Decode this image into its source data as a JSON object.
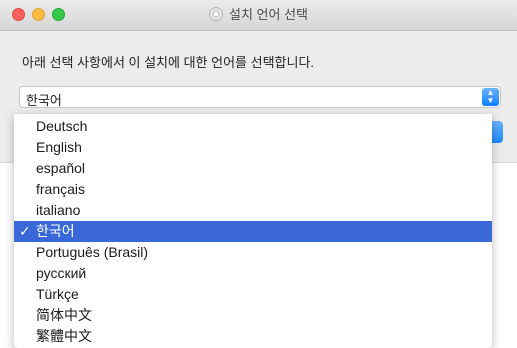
{
  "window": {
    "title": "설치 언어 선택",
    "instruction": "아래 선택 사항에서 이 설치에 대한 언어를 선택합니다."
  },
  "language_popup": {
    "selected_value": "한국어",
    "stepper_up": "▲",
    "stepper_down": "▼"
  },
  "menu": {
    "checkmark": "✓",
    "items": [
      {
        "label": "Deutsch"
      },
      {
        "label": "English"
      },
      {
        "label": "español"
      },
      {
        "label": "français"
      },
      {
        "label": "italiano"
      },
      {
        "label": "한국어",
        "selected": true
      },
      {
        "label": "Português (Brasil)"
      },
      {
        "label": "русский"
      },
      {
        "label": "Türkçe"
      },
      {
        "label": "简体中文"
      },
      {
        "label": "繁體中文"
      }
    ]
  },
  "colors": {
    "highlight": "#3a68d8",
    "accent": "#0a80ff"
  }
}
